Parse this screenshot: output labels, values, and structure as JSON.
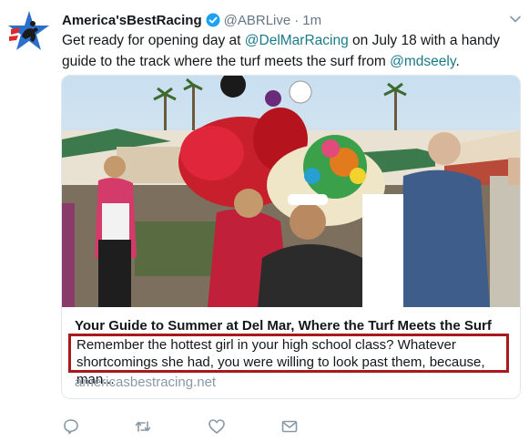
{
  "author": {
    "display_name": "America'sBestRacing",
    "handle": "@ABRLive",
    "separator": "·",
    "timestamp": "1m"
  },
  "tweet": {
    "text_1": "Get ready for opening day at ",
    "mention_1": "@DelMarRacing",
    "text_2": " on July 18 with a handy guide to the track where the turf meets the surf from ",
    "mention_2": "@mdseely",
    "text_3": "."
  },
  "card": {
    "title": "Your Guide to Summer at Del Mar, Where the Turf Meets the Surf",
    "description": "Remember the hottest girl in your high school class? Whatever shortcomings she had, you were willing to look past them, because, man...",
    "domain": "americasbestracing.net"
  },
  "icons": {
    "avatar": "racing-horse-star-logo",
    "verified": "verified-badge-icon",
    "more": "chevron-down-icon",
    "reply": "reply-icon",
    "retweet": "retweet-icon",
    "like": "heart-icon",
    "message": "envelope-icon"
  },
  "colors": {
    "link": "#1b7a88",
    "muted": "#657786",
    "highlight_box": "#a8191d",
    "verified": "#1da1f2"
  }
}
